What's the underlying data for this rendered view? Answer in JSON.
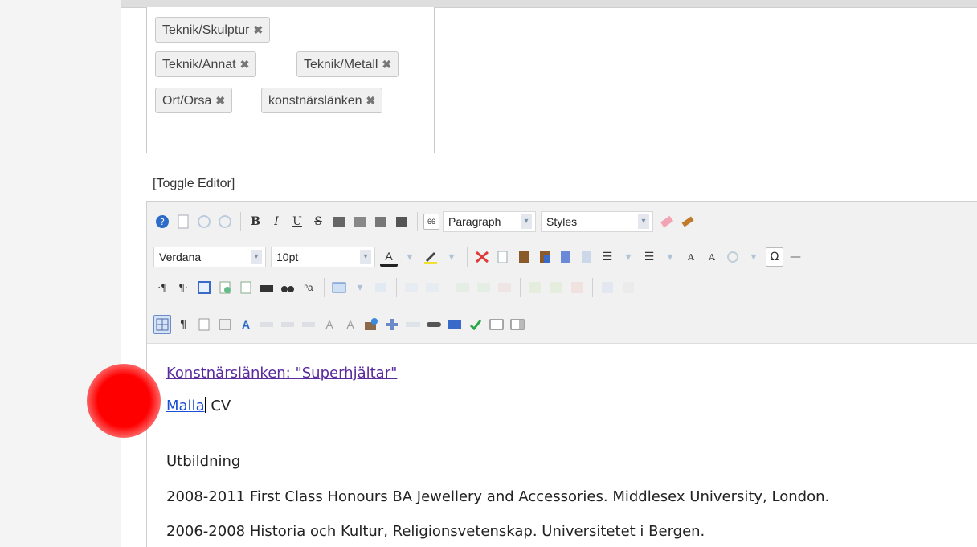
{
  "tags": [
    {
      "label": "Teknik/Skulptur"
    },
    {
      "label": "Teknik/Annat"
    },
    {
      "label": "Teknik/Metall"
    },
    {
      "label": "Ort/Orsa"
    },
    {
      "label": "konstnärslänken"
    }
  ],
  "tag_remove_glyph": "✖",
  "toggle_editor": "[Toggle Editor]",
  "toolbar": {
    "format_select": "Paragraph",
    "styles_select": "Styles",
    "font_select": "Verdana",
    "size_select": "10pt",
    "dropdown_arrow": "▾",
    "bold": "B",
    "italic": "I",
    "underline": "U",
    "strike": "S",
    "blockquote": "66",
    "omega": "Ω",
    "rule": "—",
    "show_blocks": "¶",
    "sub": "A",
    "sup": "A"
  },
  "content": {
    "link_title": "Konstnärslänken: \"Superhjältar\"",
    "name_link": "Malla",
    "name_rest": " CV",
    "heading": "Utbildning",
    "line1": "2008-2011 First Class Honours BA Jewellery and Accessories. Middlesex University, London.",
    "line2": "2006-2008 Historia och Kultur, Religionsvetenskap. Universitetet i Bergen."
  },
  "colors": {
    "cursor_marker": "#ff0000",
    "visited_link": "#5a2a9e",
    "link": "#1a4fd6"
  }
}
